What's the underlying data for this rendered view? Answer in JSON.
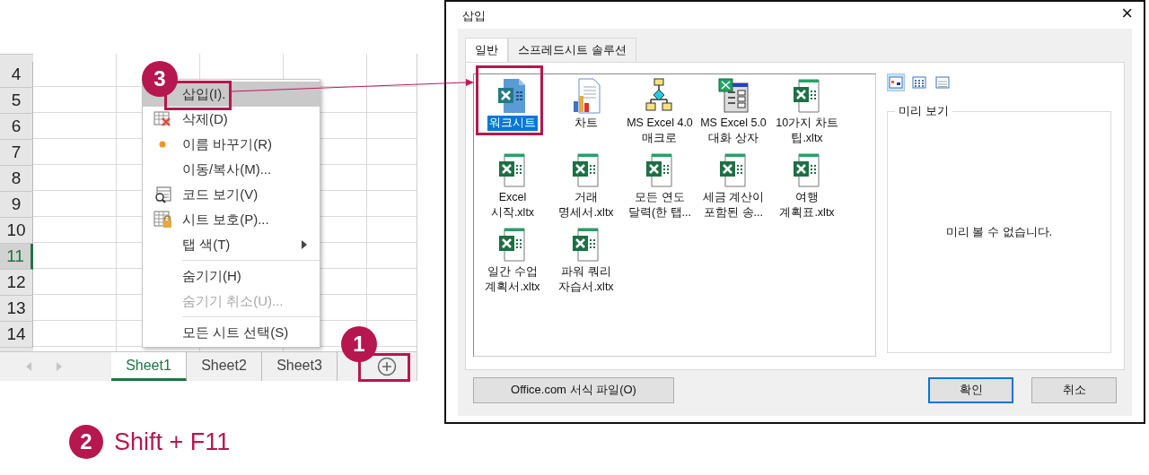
{
  "sheet": {
    "row_headers": [
      {
        "label": "4",
        "selected": false
      },
      {
        "label": "5",
        "selected": false
      },
      {
        "label": "6",
        "selected": false
      },
      {
        "label": "7",
        "selected": false
      },
      {
        "label": "8",
        "selected": false
      },
      {
        "label": "9",
        "selected": false
      },
      {
        "label": "10",
        "selected": false
      },
      {
        "label": "11",
        "selected": true
      },
      {
        "label": "12",
        "selected": false
      },
      {
        "label": "13",
        "selected": false
      },
      {
        "label": "14",
        "selected": false
      }
    ],
    "tabs": [
      {
        "label": "Sheet1",
        "selected": true
      },
      {
        "label": "Sheet2",
        "selected": false
      },
      {
        "label": "Sheet3",
        "selected": false
      }
    ]
  },
  "context_menu": {
    "items": [
      {
        "kind": "item",
        "label": "삽입(I).",
        "highlighted": true,
        "disabled": false,
        "submenu": false
      },
      {
        "kind": "item",
        "label": "삭제(D)",
        "highlighted": false,
        "disabled": false,
        "submenu": false
      },
      {
        "kind": "item",
        "label": "이름 바꾸기(R)",
        "highlighted": false,
        "disabled": false,
        "submenu": false
      },
      {
        "kind": "item",
        "label": "이동/복사(M)...",
        "highlighted": false,
        "disabled": false,
        "submenu": false
      },
      {
        "kind": "item",
        "label": "코드 보기(V)",
        "highlighted": false,
        "disabled": false,
        "submenu": false
      },
      {
        "kind": "item",
        "label": "시트 보호(P)...",
        "highlighted": false,
        "disabled": false,
        "submenu": false
      },
      {
        "kind": "item",
        "label": "탭 색(T)",
        "highlighted": false,
        "disabled": false,
        "submenu": true
      },
      {
        "kind": "separator"
      },
      {
        "kind": "item",
        "label": "숨기기(H)",
        "highlighted": false,
        "disabled": false,
        "submenu": false
      },
      {
        "kind": "item",
        "label": "숨기기 취소(U)...",
        "highlighted": false,
        "disabled": true,
        "submenu": false
      },
      {
        "kind": "separator"
      },
      {
        "kind": "item",
        "label": "모든 시트 선택(S)",
        "highlighted": false,
        "disabled": false,
        "submenu": false
      }
    ]
  },
  "dialog": {
    "title": "삽입",
    "close": "×",
    "tabs": [
      {
        "label": "일반",
        "selected": true
      },
      {
        "label": "스프레드시트 솔루션",
        "selected": false
      }
    ],
    "templates": [
      {
        "label": "워크시트",
        "selected": true
      },
      {
        "label": "차트",
        "selected": false
      },
      {
        "label": "MS Excel 4.0\n매크로",
        "selected": false
      },
      {
        "label": "MS Excel 5.0\n대화 상자",
        "selected": false
      },
      {
        "label": "10가지 차트\n팁.xltx",
        "selected": false
      },
      {
        "label": "Excel\n시작.xltx",
        "selected": false
      },
      {
        "label": "거래\n명세서.xltx",
        "selected": false
      },
      {
        "label": "모든 연도\n달력(한 탭...",
        "selected": false
      },
      {
        "label": "세금 계산이\n포함된 송...",
        "selected": false
      },
      {
        "label": "여행\n계획표.xltx",
        "selected": false
      },
      {
        "label": "일간 수업\n계획서.xltx",
        "selected": false
      },
      {
        "label": "파워 쿼리\n자습서.xltx",
        "selected": false
      }
    ],
    "view_buttons": [
      {
        "selected": true
      },
      {
        "selected": false
      },
      {
        "selected": false
      }
    ],
    "preview": {
      "legend": "미리 보기",
      "message": "미리 볼 수 없습니다."
    },
    "buttons": [
      {
        "label": "Office.com 서식 파일(O)",
        "default": false
      },
      {
        "label": "확인",
        "default": true
      },
      {
        "label": "취소",
        "default": false
      }
    ]
  },
  "callouts": [
    {
      "number": "3"
    },
    {
      "number": "1"
    }
  ],
  "shortcut": {
    "number": "2",
    "text": "Shift + F11"
  }
}
